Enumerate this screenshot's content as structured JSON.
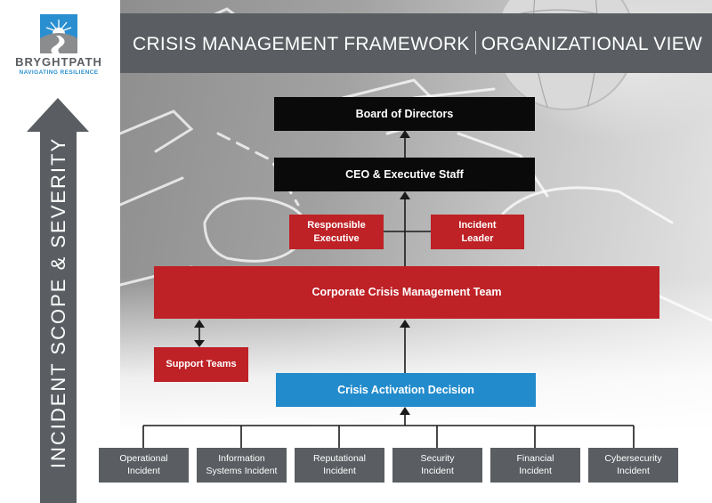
{
  "logo": {
    "name": "BRYGHTPATH",
    "tagline": "NAVIGATING RESILIENCE",
    "colors": {
      "sky": "#2a8fd0",
      "road": "#8a8c8e",
      "name": "#5a5e62"
    }
  },
  "header": {
    "title_left": "CRISIS MANAGEMENT FRAMEWORK",
    "title_right": "ORGANIZATIONAL VIEW"
  },
  "side_arrow": {
    "label": "INCIDENT SCOPE & SEVERITY",
    "direction": "up"
  },
  "nodes": {
    "board": "Board of Directors",
    "ceo": "CEO & Executive Staff",
    "responsible_executive": [
      "Responsible",
      "Executive"
    ],
    "incident_leader": [
      "Incident",
      "Leader"
    ],
    "ccmt": "Corporate Crisis Management Team",
    "support_teams": "Support Teams",
    "activation": "Crisis Activation Decision"
  },
  "incidents": [
    {
      "line1": "Operational",
      "line2": "Incident"
    },
    {
      "line1": "Information",
      "line2": "Systems Incident"
    },
    {
      "line1": "Reputational",
      "line2": "Incident"
    },
    {
      "line1": "Security",
      "line2": "Incident"
    },
    {
      "line1": "Financial",
      "line2": "Incident"
    },
    {
      "line1": "Cybersecurity",
      "line2": "Incident"
    }
  ],
  "colors": {
    "executive": "#0a0a0a",
    "team": "#be2126",
    "decision": "#228bcc",
    "incident": "#5a5e62",
    "header": "#5a5e62"
  }
}
